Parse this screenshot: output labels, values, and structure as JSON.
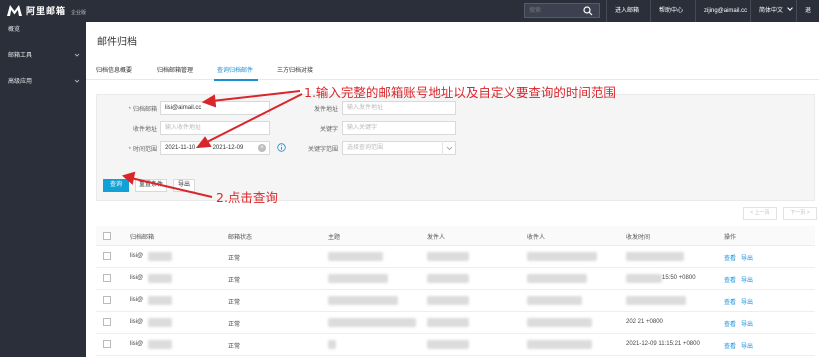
{
  "topbar": {
    "brand": "阿里邮箱",
    "brand_sub": "企业版",
    "search_placeholder": "搜索",
    "nav": [
      "进入邮箱",
      "帮助中心",
      "zijing@aimail.cc",
      "简体中文",
      "退出"
    ]
  },
  "sidebar": {
    "items": [
      {
        "label": "概览",
        "has_chevron": false
      },
      {
        "label": "邮箱工具",
        "has_chevron": true
      },
      {
        "label": "高级应用",
        "has_chevron": true
      }
    ]
  },
  "page": {
    "title": "邮件归档"
  },
  "tabs": [
    "归档信息概要",
    "归档邮箱管理",
    "查询归档邮件",
    "三方归档对接"
  ],
  "active_tab": 2,
  "form": {
    "archive_mailbox_label": "归档邮箱",
    "archive_mailbox_value": "lisi@aimail.cc",
    "sender_label": "发件地址",
    "sender_placeholder": "输入发件地址",
    "recipient_label": "收件地址",
    "recipient_placeholder": "输入收件地址",
    "keyword_label": "关键字",
    "keyword_placeholder": "输入关键字",
    "time_label": "时间范围",
    "date_from": "2021-11-10",
    "date_sep": "-",
    "date_to": "2021-12-09",
    "keyword_scope_label": "关键字范围",
    "keyword_scope_placeholder": "选择查询范围",
    "query_button": "查询",
    "reset_button": "重置条件",
    "export_button": "导出"
  },
  "pager": {
    "prev": "< 上一页",
    "next": "下一页 >"
  },
  "table": {
    "headers": [
      "归档邮箱",
      "邮箱状态",
      "主题",
      "发件人",
      "收件人",
      "收发时间",
      "操作"
    ],
    "rows": [
      {
        "mailbox": "lisi@",
        "status": "正常",
        "time": "",
        "view": "查看",
        "export": "导出"
      },
      {
        "mailbox": "lisi@",
        "status": "正常",
        "time": "15:50 +0800",
        "view": "查看",
        "export": "导出"
      },
      {
        "mailbox": "lisi@",
        "status": "正常",
        "time": "",
        "view": "查看",
        "export": "导出"
      },
      {
        "mailbox": "lisi@",
        "status": "正常",
        "time": "202         21 +0800",
        "view": "查看",
        "export": "导出"
      },
      {
        "mailbox": "lisi@",
        "status": "正常",
        "time": "2021-12-09 11:15:21 +0800",
        "view": "查看",
        "export": "导出"
      }
    ]
  },
  "annotations": {
    "step1": "1.输入完整的邮箱账号地址以及自定义要查询的时间范围",
    "step2": "2.点击查询"
  },
  "colors": {
    "accent": "#12a1d7",
    "annotation": "#d9262b",
    "topbar": "#2b2f3a"
  }
}
